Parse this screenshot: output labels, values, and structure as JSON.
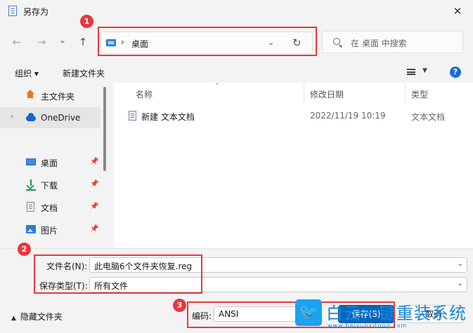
{
  "window": {
    "title": "另存为",
    "close_glyph": "✕"
  },
  "nav": {
    "back": "←",
    "forward": "→",
    "recent": "⌄",
    "up": "↑"
  },
  "address": {
    "chevron": "›",
    "crumb": "桌面",
    "dropdown": "⌄",
    "refresh": "↻"
  },
  "search": {
    "placeholder": "在 桌面 中搜索"
  },
  "toolbar": {
    "organize": "组织 ▾",
    "new_folder": "新建文件夹",
    "view_dropdown": "▼",
    "help": "?"
  },
  "sidebar": {
    "items": [
      {
        "label": "主文件夹",
        "icon": "home-icon"
      },
      {
        "label": "OneDrive",
        "icon": "cloud-icon",
        "chevron": "›",
        "selected": true
      },
      {
        "label": "桌面",
        "icon": "desktop-icon",
        "pinned": true
      },
      {
        "label": "下载",
        "icon": "download-icon",
        "pinned": true
      },
      {
        "label": "文档",
        "icon": "documents-icon",
        "pinned": true
      },
      {
        "label": "图片",
        "icon": "pictures-icon",
        "pinned": true
      }
    ],
    "pin_glyph": "📌"
  },
  "filelist": {
    "columns": [
      "名称",
      "修改日期",
      "类型"
    ],
    "sort_glyph": "⌃",
    "rows": [
      {
        "name": "新建 文本文档",
        "modified": "2022/11/19 10:19",
        "type": "文本文档"
      }
    ]
  },
  "form": {
    "filename_label": "文件名(N):",
    "filename_value": "此电脑6个文件夹恢复.reg",
    "filetype_label": "保存类型(T):",
    "filetype_value": "所有文件",
    "encoding_label": "编码:",
    "encoding_value": "ANSI",
    "dropdown": "⌄"
  },
  "footer": {
    "hide_folders": "隐藏文件夹",
    "caret": "▲",
    "save": "保存(S)",
    "cancel": "取消"
  },
  "annotations": [
    "1",
    "2",
    "3"
  ],
  "watermark": {
    "text": "白云一键重装系统",
    "url": "www.baiyunxitong.com",
    "bird": "🐦"
  },
  "colors": {
    "annotation_red": "#e8383d",
    "primary_blue": "#0067c0",
    "watermark_blue": "#1b86d6"
  }
}
